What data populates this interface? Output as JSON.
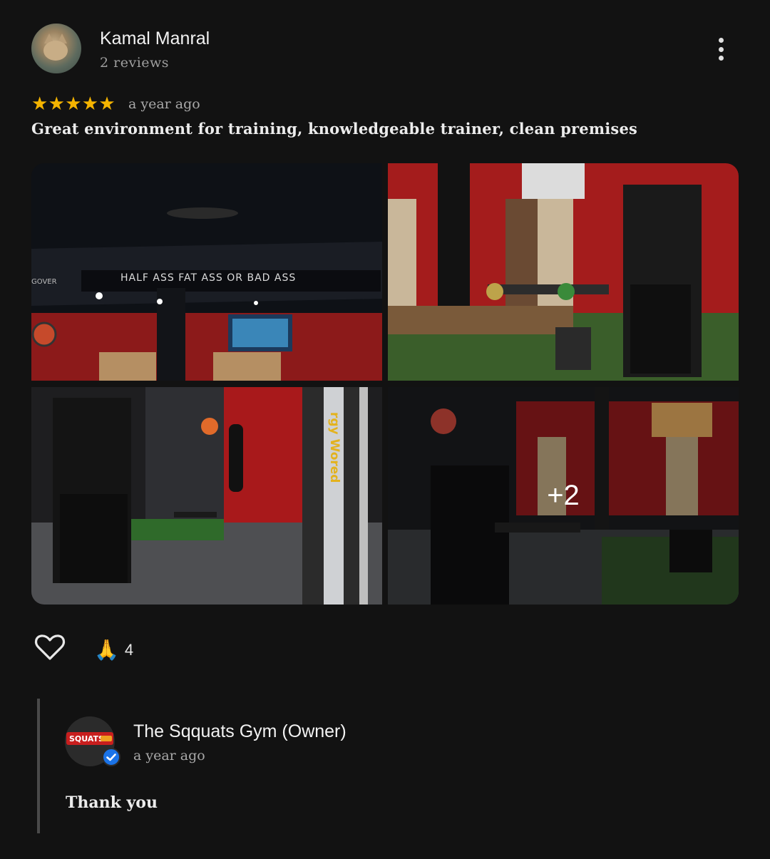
{
  "review": {
    "reviewer_name": "Kamal Manral",
    "reviewer_stats": "2 reviews",
    "rating": 5,
    "stars": [
      "★",
      "★",
      "★",
      "★",
      "★"
    ],
    "time": "a year ago",
    "text": "Great environment for training, knowledgeable trainer, clean premises",
    "photos": {
      "more_count_label": "+2",
      "photo1_sign": "HALF ASS FAT ASS OR BAD ASS",
      "photo1_side_sign": "GOVER",
      "photo3_vertical_sign": "rgy Wored"
    },
    "reactions": {
      "emoji": "🙏",
      "count": "4"
    }
  },
  "reply": {
    "owner_name": "The Sqquats Gym (Owner)",
    "time": "a year ago",
    "text": "Thank you",
    "logo_text": "SQUATS"
  },
  "colors": {
    "background": "#121212",
    "star": "#f5b400",
    "verified": "#1a73e8"
  },
  "icons": {
    "more": "more-vert-icon",
    "like": "heart-outline-icon",
    "verified": "verified-check-icon"
  }
}
